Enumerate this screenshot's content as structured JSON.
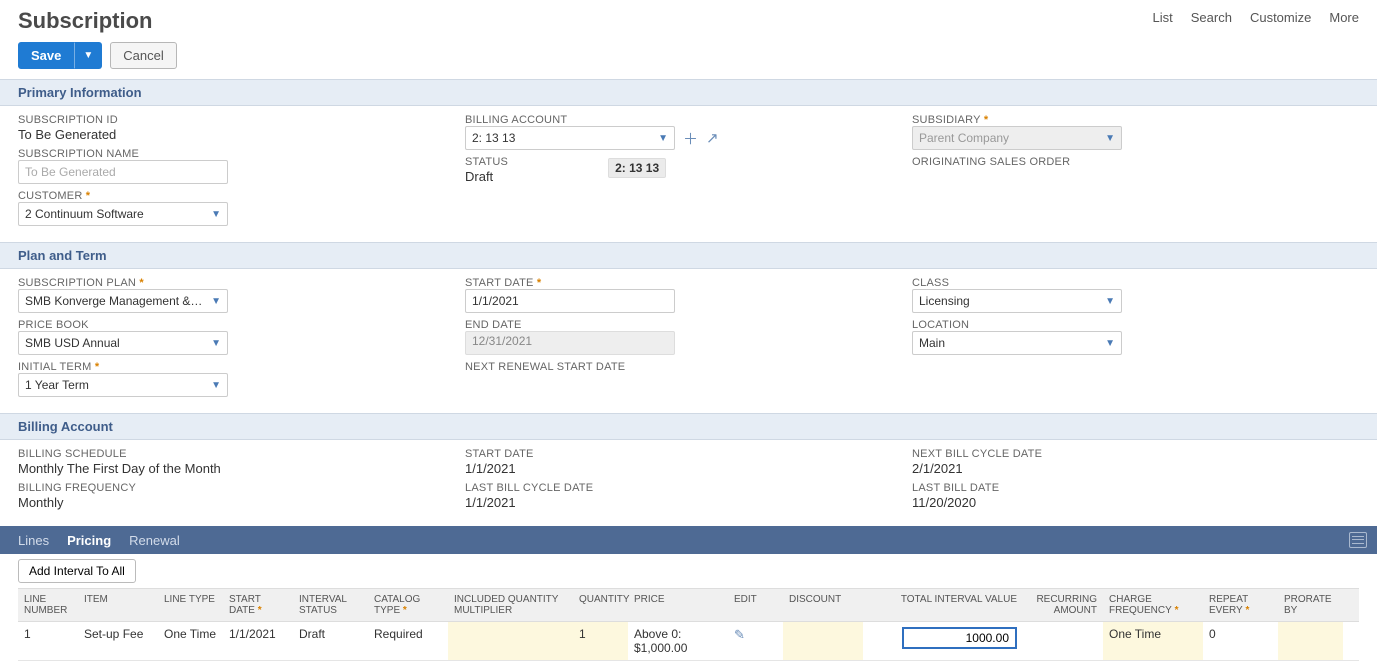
{
  "header": {
    "title": "Subscription",
    "actions": [
      "List",
      "Search",
      "Customize",
      "More"
    ]
  },
  "buttons": {
    "save": "Save",
    "cancel": "Cancel"
  },
  "sections": {
    "primary": {
      "title": "Primary Information",
      "subscription_id_label": "SUBSCRIPTION ID",
      "subscription_id_value": "To Be Generated",
      "subscription_name_label": "SUBSCRIPTION NAME",
      "subscription_name_placeholder": "To Be Generated",
      "customer_label": "CUSTOMER",
      "customer_value": "2 Continuum Software",
      "billing_account_label": "BILLING ACCOUNT",
      "billing_account_value": "2: 13 13",
      "billing_account_tooltip": "2: 13 13",
      "status_label": "STATUS",
      "status_value": "Draft",
      "subsidiary_label": "SUBSIDIARY",
      "subsidiary_value": "Parent Company",
      "originating_order_label": "ORIGINATING SALES ORDER"
    },
    "plan": {
      "title": "Plan and Term",
      "plan_label": "SUBSCRIPTION PLAN",
      "plan_value": "SMB Konverge Management & Storage",
      "pricebook_label": "PRICE BOOK",
      "pricebook_value": "SMB USD Annual",
      "initial_term_label": "INITIAL TERM",
      "initial_term_value": "1 Year Term",
      "start_date_label": "START DATE",
      "start_date_value": "1/1/2021",
      "end_date_label": "END DATE",
      "end_date_value": "12/31/2021",
      "next_renewal_label": "NEXT RENEWAL START DATE",
      "class_label": "CLASS",
      "class_value": "Licensing",
      "location_label": "LOCATION",
      "location_value": "Main"
    },
    "billing": {
      "title": "Billing Account",
      "schedule_label": "BILLING SCHEDULE",
      "schedule_value": "Monthly The First Day of the Month",
      "frequency_label": "BILLING FREQUENCY",
      "frequency_value": "Monthly",
      "start_label": "START DATE",
      "start_value": "1/1/2021",
      "lastcycle_label": "LAST BILL CYCLE DATE",
      "lastcycle_value": "1/1/2021",
      "nextcycle_label": "NEXT BILL CYCLE DATE",
      "nextcycle_value": "2/1/2021",
      "lastbill_label": "LAST BILL DATE",
      "lastbill_value": "11/20/2020"
    }
  },
  "tabs": {
    "lines": "Lines",
    "pricing": "Pricing",
    "renewal": "Renewal"
  },
  "pricing": {
    "add_interval": "Add Interval To All",
    "columns": {
      "linenum": "LINE NUMBER",
      "item": "ITEM",
      "linetype": "LINE TYPE",
      "startdate": "START DATE",
      "intstatus": "INTERVAL STATUS",
      "cattype": "CATALOG TYPE",
      "incqty": "INCLUDED QUANTITY MULTIPLIER",
      "qty": "QUANTITY",
      "price": "PRICE",
      "edit": "EDIT",
      "discount": "DISCOUNT",
      "total": "TOTAL INTERVAL VALUE",
      "recamt": "RECURRING AMOUNT",
      "chgfreq": "CHARGE FREQUENCY",
      "repeat": "REPEAT EVERY",
      "prorate": "PRORATE BY"
    },
    "row": {
      "linenum": "1",
      "item": "Set-up Fee",
      "linetype": "One Time",
      "startdate": "1/1/2021",
      "intstatus": "Draft",
      "cattype": "Required",
      "qty": "1",
      "price": "Above 0: $1,000.00",
      "total": "1000.00",
      "chgfreq": "One Time",
      "repeat": "0"
    }
  }
}
